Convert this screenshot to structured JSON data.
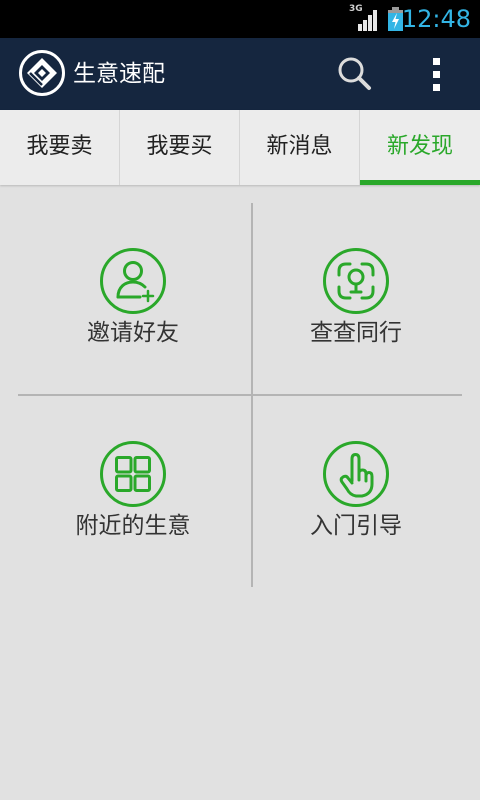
{
  "status_bar": {
    "network": "3G",
    "time": "12:48",
    "icons": [
      "signal-icon",
      "battery-charging-icon"
    ]
  },
  "app_bar": {
    "title": "生意速配",
    "logo_icon": "app-logo-icon",
    "search_icon": "search-icon",
    "menu_icon": "overflow-menu-icon"
  },
  "tabs": [
    {
      "label": "我要卖",
      "selected": false
    },
    {
      "label": "我要买",
      "selected": false
    },
    {
      "label": "新消息",
      "selected": false
    },
    {
      "label": "新发现",
      "selected": true
    }
  ],
  "discover_grid": [
    {
      "label": "邀请好友",
      "icon": "add-friend-icon"
    },
    {
      "label": "查查同行",
      "icon": "locate-peers-icon"
    },
    {
      "label": "附近的生意",
      "icon": "grid-icon"
    },
    {
      "label": "入门引导",
      "icon": "hand-pointer-icon"
    }
  ],
  "colors": {
    "app_bar": "#15263f",
    "accent_green": "#2aa82a",
    "time_blue": "#33b5e5",
    "tab_bg": "#ececec",
    "content_bg": "#e1e1e1",
    "text": "#333333"
  }
}
